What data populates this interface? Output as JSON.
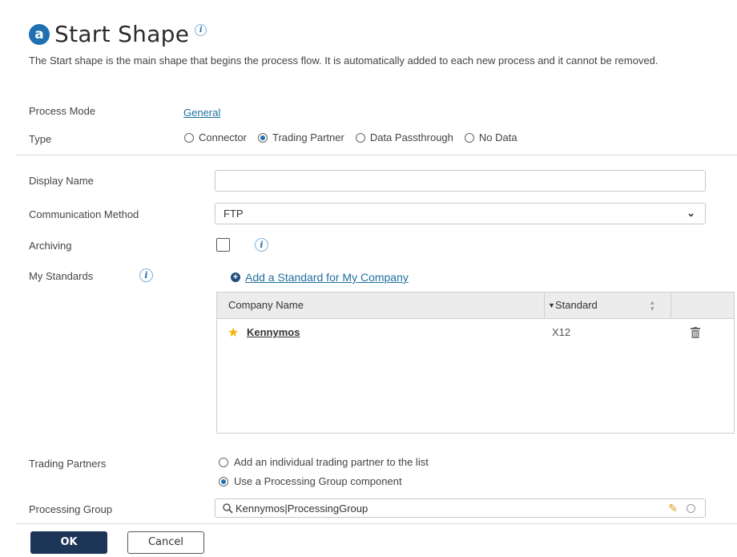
{
  "header": {
    "logo_letter": "a",
    "title": "Start Shape",
    "info_glyph": "i",
    "description": "The Start shape is the main shape that begins the process flow. It is automatically added to each new process and it cannot be removed."
  },
  "process_mode": {
    "label": "Process Mode",
    "value": "General"
  },
  "type": {
    "label": "Type",
    "options": [
      {
        "label": "Connector",
        "selected": false
      },
      {
        "label": "Trading Partner",
        "selected": true
      },
      {
        "label": "Data Passthrough",
        "selected": false
      },
      {
        "label": "No Data",
        "selected": false
      }
    ]
  },
  "display_name": {
    "label": "Display Name",
    "value": ""
  },
  "communication_method": {
    "label": "Communication Method",
    "value": "FTP"
  },
  "archiving": {
    "label": "Archiving",
    "checked": false
  },
  "my_standards": {
    "label": "My Standards",
    "add_link": "Add a Standard for My Company",
    "columns": [
      "Company Name",
      "Standard"
    ],
    "rows": [
      {
        "company": "Kennymos",
        "standard": "X12",
        "default": true
      }
    ]
  },
  "trading_partners": {
    "label": "Trading Partners",
    "options": [
      {
        "label": "Add an individual trading partner to the list",
        "selected": false
      },
      {
        "label": "Use a Processing Group component",
        "selected": true
      }
    ]
  },
  "processing_group": {
    "label": "Processing Group",
    "value": "Kennymos|ProcessingGroup"
  },
  "footer": {
    "ok_label": "OK",
    "cancel_label": "Cancel"
  },
  "colors": {
    "accent": "#1f6fb2",
    "primary_button": "#1d3557",
    "star": "#f0b800",
    "link": "#1f6fa0"
  },
  "icons": [
    "info-icon",
    "search-icon",
    "pencil-icon",
    "trash-icon",
    "star-icon",
    "chevron-down-icon",
    "plus-circle-icon",
    "sort-icon"
  ]
}
